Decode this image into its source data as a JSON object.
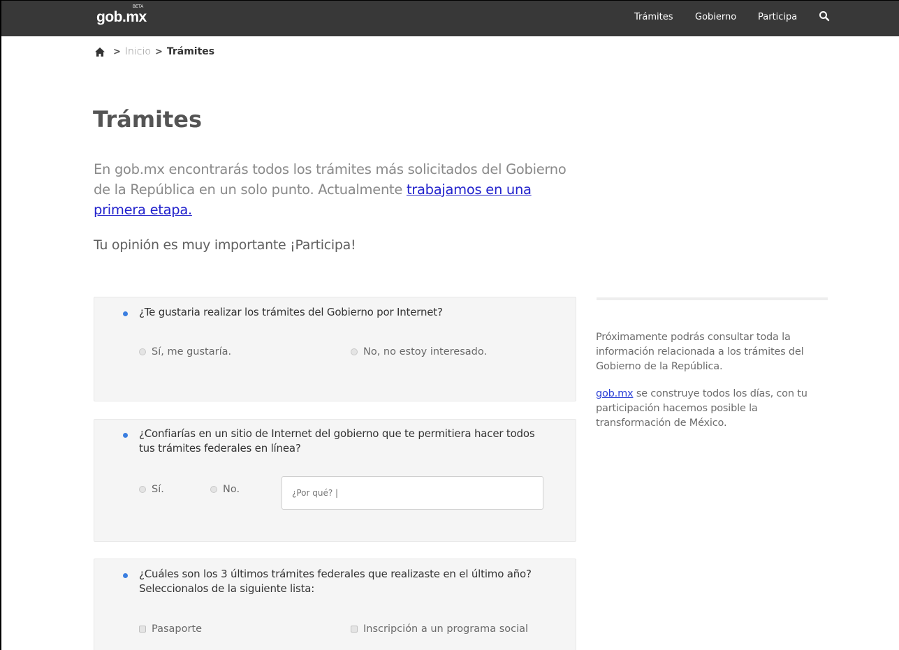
{
  "header": {
    "logo_text": "gob",
    "logo_dot": ".",
    "logo_mx": "mx",
    "logo_badge": "BETA",
    "nav": [
      {
        "label": "Trámites"
      },
      {
        "label": "Gobierno"
      },
      {
        "label": "Participa"
      }
    ],
    "search_icon": "search-icon",
    "bg_color": "#383838"
  },
  "breadcrumb": {
    "home_icon": "home-icon",
    "separator": ">",
    "items": [
      "Inicio",
      "Trámites"
    ]
  },
  "page": {
    "title": "Trámites",
    "intro_text": "En gob.mx encontrarás todos los trámites más solicitados del Gobierno de la República en un solo punto. Actualmente ",
    "intro_link": "trabajamos en una primera etapa.",
    "participa": "Tu opinión es muy importante ¡Participa!"
  },
  "survey": {
    "q1": {
      "question": "¿Te gustaria realizar los trámites del Gobierno por Internet?",
      "options": [
        "Sí, me gustaría.",
        "No, no estoy interesado."
      ]
    },
    "q2": {
      "question": "¿Confiarías en un sitio de Internet del gobierno que te permitiera hacer todos tus trámites federales en línea?",
      "options": [
        "Sí.",
        "No."
      ],
      "input_placeholder": "¿Por qué? |"
    },
    "q3": {
      "question": "¿Cuáles son los 3 últimos trámites federales que realizaste en el último año? Seleccionalos de la siguiente lista:",
      "options": [
        "Pasaporte",
        "Inscripción a un programa social"
      ]
    },
    "bullet_color": "#3a7ee0"
  },
  "sidebar": {
    "paragraph1": "Próximamente podrás consultar toda la información relacionada a los trámites del Gobierno de la República.",
    "link": "gob.mx",
    "paragraph2_rest": " se construye todos los días, con tu participación hacemos posible la transformación de México."
  }
}
